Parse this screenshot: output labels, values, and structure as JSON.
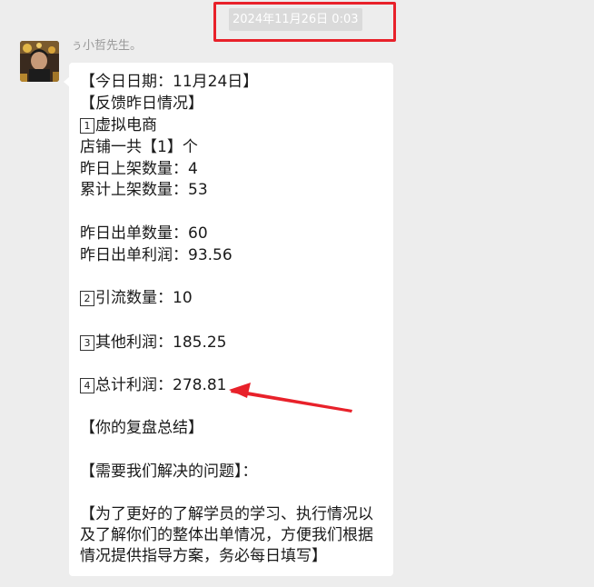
{
  "header": {
    "timestamp": "2024年11月26日 0:03"
  },
  "message": {
    "sender_name": "ぅ小哲先生。",
    "lines": {
      "l1": "【今日日期：11月24日】",
      "l2": "【反馈昨日情况】",
      "l3_num": "1",
      "l3_text": "虚拟电商",
      "l4": "店铺一共【1】个",
      "l5": "昨日上架数量：4",
      "l6": "累计上架数量：53",
      "l7": "昨日出单数量：60",
      "l8": "昨日出单利润：93.56",
      "l9_num": "2",
      "l9_text": "引流数量：10",
      "l10_num": "3",
      "l10_text": "其他利润：185.25",
      "l11_num": "4",
      "l11_text": "总计利润：278.81",
      "l12": "【你的复盘总结】",
      "l13": "【需要我们解决的问题】：",
      "l14": "【为了更好的了解学员的学习、执行情况以",
      "l15": "及了解你们的整体出单情况，方便我们根据",
      "l16": "情况提供指导方案，务必每日填写】"
    }
  },
  "colors": {
    "highlight": "#e8212a",
    "background": "#ededed",
    "bubble": "#ffffff"
  }
}
